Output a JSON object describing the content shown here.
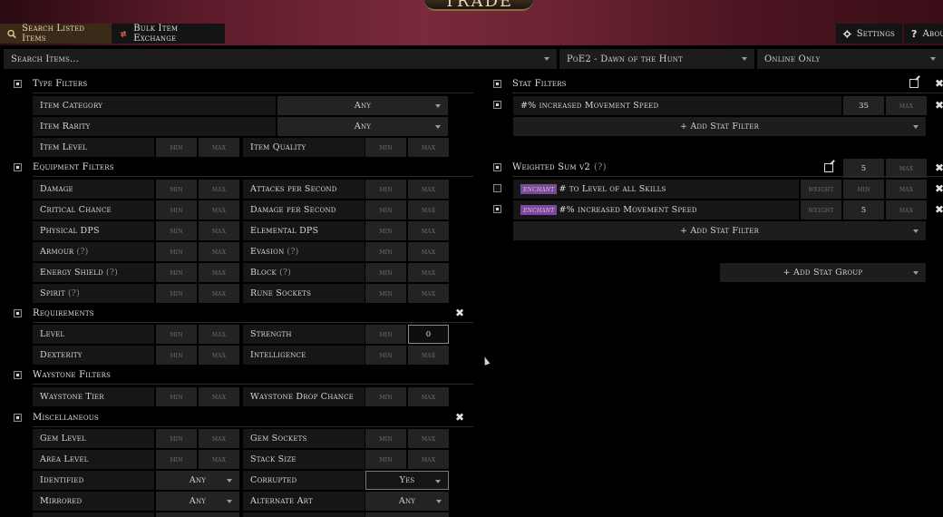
{
  "header": {
    "logo_text": "TRADE",
    "tabs": {
      "search": "Search Listed Items",
      "bulk": "Bulk Item Exchange",
      "settings": "Settings",
      "about": "About"
    }
  },
  "search_row": {
    "search_placeholder": "Search Items...",
    "league": "PoE2 - Dawn of the Hunt",
    "status": "Online Only"
  },
  "placeholders": {
    "min": "min",
    "max": "max",
    "any": "Any",
    "weight": "weight"
  },
  "type_filters": {
    "title": "Type Filters",
    "item_category": {
      "label": "Item Category",
      "value": "Any"
    },
    "item_rarity": {
      "label": "Item Rarity",
      "value": "Any"
    },
    "item_level": "Item Level",
    "item_quality": "Item Quality"
  },
  "equipment_filters": {
    "title": "Equipment Filters",
    "rows": [
      {
        "left": "Damage",
        "left_q": "",
        "right": "Attacks per Second",
        "right_q": ""
      },
      {
        "left": "Critical Chance",
        "left_q": "",
        "right": "Damage per Second",
        "right_q": ""
      },
      {
        "left": "Physical DPS",
        "left_q": "",
        "right": "Elemental DPS",
        "right_q": ""
      },
      {
        "left": "Armour",
        "left_q": "(?)",
        "right": "Evasion",
        "right_q": "(?)"
      },
      {
        "left": "Energy Shield",
        "left_q": "(?)",
        "right": "Block",
        "right_q": "(?)"
      },
      {
        "left": "Spirit",
        "left_q": "(?)",
        "right": "Rune Sockets",
        "right_q": ""
      }
    ]
  },
  "requirements": {
    "title": "Requirements",
    "level": "Level",
    "strength": "Strength",
    "strength_min": "0",
    "dexterity": "Dexterity",
    "intelligence": "Intelligence"
  },
  "waystone_filters": {
    "title": "Waystone Filters",
    "tier": "Waystone Tier",
    "drop_chance": "Waystone Drop Chance"
  },
  "misc": {
    "title": "Miscellaneous",
    "gem_level": "Gem Level",
    "gem_sockets": "Gem Sockets",
    "area_level": "Area Level",
    "stack_size": "Stack Size",
    "identified": {
      "label": "Identified",
      "value": "Any"
    },
    "corrupted": {
      "label": "Corrupted",
      "value": "Yes"
    },
    "mirrored": {
      "label": "Mirrored",
      "value": "Any"
    },
    "alternate_art": {
      "label": "Alternate Art",
      "value": "Any"
    }
  },
  "stat_filters": {
    "title": "Stat Filters",
    "stat": {
      "text": "#% increased Movement Speed",
      "min": "35"
    },
    "add_label": "+ Add Stat Filter"
  },
  "weighted_sum": {
    "title": "Weighted Sum v2",
    "title_q": "(?)",
    "min": "5",
    "stats": [
      {
        "tag": "enchant",
        "text": "# to Level of all Skills",
        "weight": "",
        "enabled": false
      },
      {
        "tag": "enchant",
        "text": "#% increased Movement Speed",
        "weight": "5",
        "enabled": true
      }
    ],
    "add_label": "+ Add Stat Filter"
  },
  "add_stat_group": "+ Add Stat Group"
}
